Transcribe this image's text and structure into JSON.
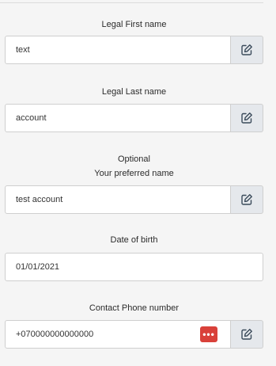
{
  "fields": {
    "first_name": {
      "label": "Legal First name",
      "value": "text"
    },
    "last_name": {
      "label": "Legal Last name",
      "value": "account"
    },
    "preferred_name": {
      "optional_label": "Optional",
      "label": "Your preferred name",
      "value": "test account"
    },
    "date_of_birth": {
      "label": "Date of birth",
      "value": "01/01/2021"
    },
    "phone": {
      "label": "Contact Phone number",
      "value": "+070000000000000",
      "badge_text": "•••"
    }
  },
  "icons": {
    "edit": "edit-pencil-icon",
    "password_manager": "password-dots-icon"
  },
  "colors": {
    "edit_button_bg": "#e5e8ec",
    "edit_icon": "#3a4a5a",
    "badge_bg": "#d9413a",
    "page_bg": "#f5f5f5"
  }
}
